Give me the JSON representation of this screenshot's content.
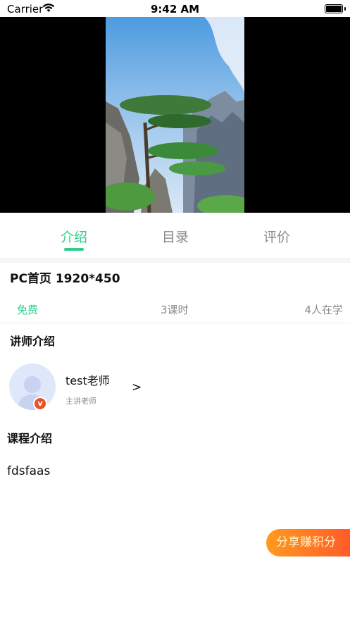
{
  "status_bar": {
    "carrier": "Carrier",
    "time": "9:42 AM"
  },
  "tabs": [
    {
      "label": "介绍",
      "active": true
    },
    {
      "label": "目录",
      "active": false
    },
    {
      "label": "评价",
      "active": false
    }
  ],
  "course": {
    "title": "PC首页 1920*450",
    "price": "免费",
    "lessons": "3课时",
    "learners": "4人在学"
  },
  "teacher_section": {
    "title": "讲师介绍",
    "name": "test老师",
    "role": "主讲老师",
    "arrow": ">",
    "badge": "v"
  },
  "course_section": {
    "title": "课程介绍",
    "description": "fdsfaas"
  },
  "share_button": {
    "label": "分享赚积分"
  },
  "colors": {
    "accent": "#2fcf8b",
    "share_start": "#ff9a1e",
    "share_end": "#ff5b2a",
    "badge": "#e8522b"
  }
}
